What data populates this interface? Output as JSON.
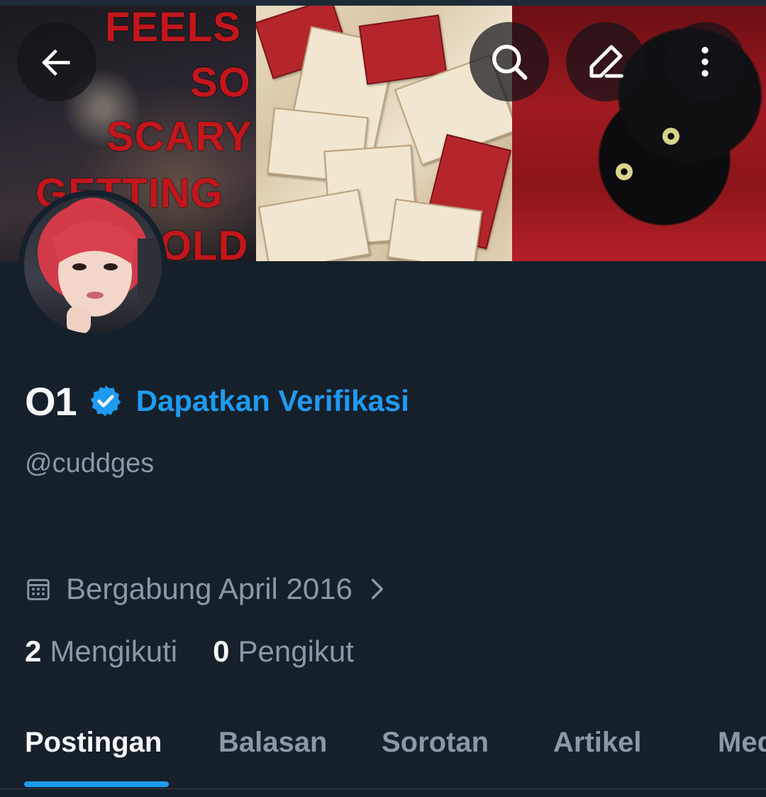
{
  "profile": {
    "display_name": "O1",
    "get_verified_label": "Dapatkan Verifikasi",
    "handle": "@cuddges",
    "joined": "Bergabung April 2016"
  },
  "stats": {
    "following_count": "2",
    "following_label": "Mengikuti",
    "followers_count": "0",
    "followers_label": "Pengikut"
  },
  "banner": {
    "text_lines": [
      "FEELS",
      "SO",
      "SCARY",
      "GETTING",
      "OLD"
    ]
  },
  "icons": {
    "back": "arrow-left-icon",
    "search": "search-icon",
    "edit": "edit-icon",
    "more": "more-vertical-icon",
    "verified": "verified-badge-icon",
    "calendar": "calendar-icon",
    "chevron": "chevron-right-icon"
  },
  "tabs": [
    {
      "label": "Postingan",
      "active": true
    },
    {
      "label": "Balasan",
      "active": false
    },
    {
      "label": "Sorotan",
      "active": false
    },
    {
      "label": "Artikel",
      "active": false
    },
    {
      "label": "Media",
      "active": false
    }
  ],
  "colors": {
    "background": "#15202b",
    "accent": "#1d9bf0",
    "primary_text": "#f7f9f9",
    "secondary_text": "#8b98a5"
  }
}
